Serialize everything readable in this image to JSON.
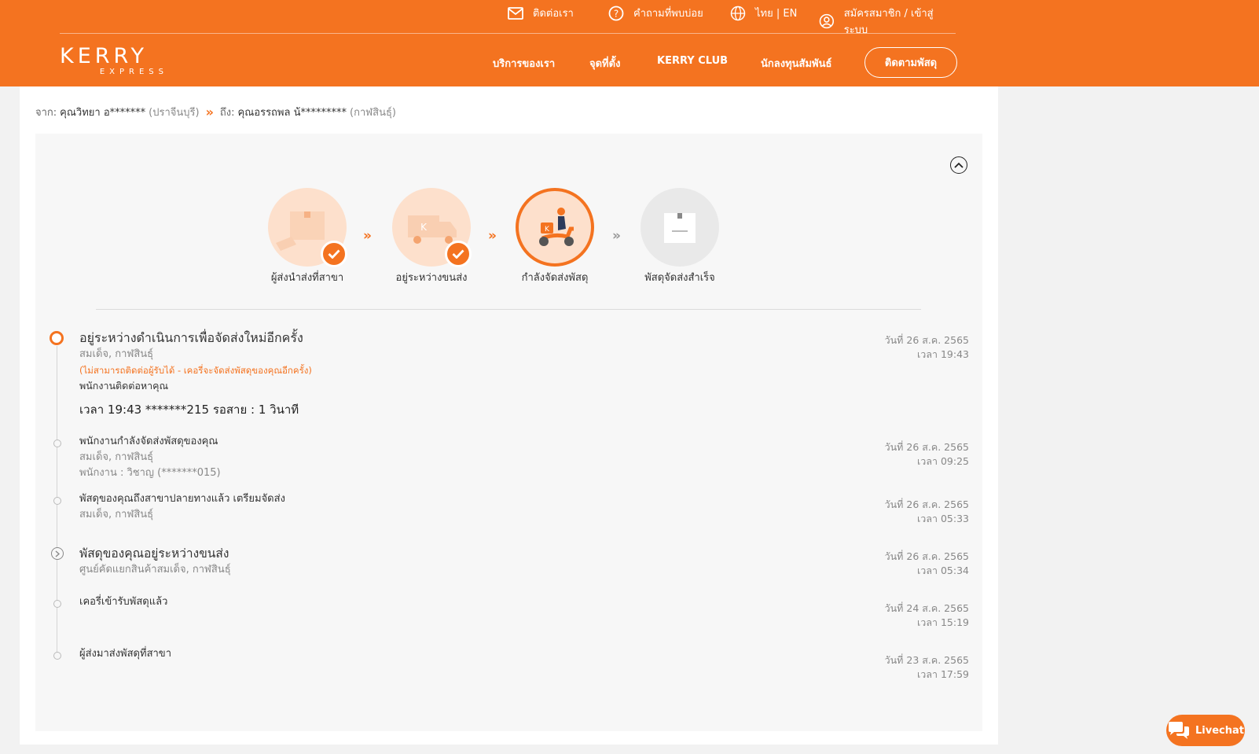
{
  "header": {
    "top_links": {
      "contact": "ติดต่อเรา",
      "faq": "คำถามที่พบบ่อย",
      "language": "ไทย | EN",
      "account": "สมัครสมาชิก / เข้าสู่ระบบ"
    },
    "logo_main": "KERRY",
    "logo_sub": "EXPRESS",
    "nav": {
      "services": "บริการของเรา",
      "locations": "จุดที่ตั้ง",
      "club": "KERRY CLUB",
      "investors": "นักลงทุนสัมพันธ์",
      "track": "ติดตามพัสดุ"
    }
  },
  "shipment": {
    "from_label": "จาก:",
    "from_name": "คุณวิทยา อ*******",
    "from_city": "(ปราจีนบุรี)",
    "to_label": "ถึง:",
    "to_name": "คุณอรรถพล น้*********",
    "to_city": "(กาฬสินธุ์)"
  },
  "steps": [
    {
      "label": "ผู้ส่งนำส่งที่สาขา",
      "state": "done"
    },
    {
      "label": "อยู่ระหว่างขนส่ง",
      "state": "done"
    },
    {
      "label": "กำลังจัดส่งพัสดุ",
      "state": "active"
    },
    {
      "label": "พัสดุจัดส่งสำเร็จ",
      "state": "todo"
    }
  ],
  "events": [
    {
      "title": "อยู่ระหว่างดำเนินการเพื่อจัดส่งใหม่อีกครั้ง",
      "location": "สมเด็จ, กาฬสินธุ์",
      "note": "(ไม่สามารถติดต่อผู้รับได้ - เคอรี่จะจัดส่งพัสดุของคุณอีกครั้ง)",
      "line": "พนักงานติดต่อหาคุณ",
      "phone": "เวลา 19:43 *******215 รอสาย : 1 วินาที",
      "date": "วันที่ 26 ส.ค. 2565",
      "time": "เวลา 19:43"
    },
    {
      "title": "พนักงานกำลังจัดส่งพัสดุของคุณ",
      "location": "สมเด็จ, กาฬสินธุ์",
      "staff": "พนักงาน : วิชาญ (*******015)",
      "date": "วันที่ 26 ส.ค. 2565",
      "time": "เวลา 09:25"
    },
    {
      "title": "พัสดุของคุณถึงสาขาปลายทางแล้ว เตรียมจัดส่ง",
      "location": "สมเด็จ, กาฬสินธุ์",
      "date": "วันที่ 26 ส.ค. 2565",
      "time": "เวลา 05:33"
    },
    {
      "title": "พัสดุของคุณอยู่ระหว่างขนส่ง",
      "location": "ศูนย์คัดแยกสินค้าสมเด็จ, กาฬสินธุ์",
      "date": "วันที่ 26 ส.ค. 2565",
      "time": "เวลา 05:34"
    },
    {
      "title": "เคอรี่เข้ารับพัสดุแล้ว",
      "date": "วันที่ 24 ส.ค. 2565",
      "time": "เวลา 15:19"
    },
    {
      "title": "ผู้ส่งมาส่งพัสดุที่สาขา",
      "date": "วันที่ 23 ส.ค. 2565",
      "time": "เวลา 17:59"
    }
  ],
  "livechat": "Livechat",
  "colors": {
    "brand": "#f47320",
    "panel": "#f7f7f7"
  }
}
